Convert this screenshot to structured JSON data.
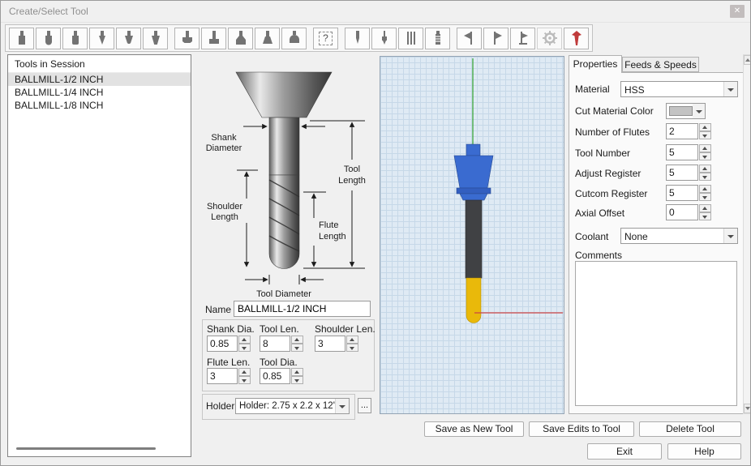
{
  "window": {
    "title": "Create/Select Tool",
    "close_glyph": "✕"
  },
  "toolbar": {
    "icons": [
      {
        "name": "flat-end-mill-icon",
        "glyph": "flat"
      },
      {
        "name": "ball-end-mill-icon",
        "glyph": "ball"
      },
      {
        "name": "bull-nose-mill-icon",
        "glyph": "bull"
      },
      {
        "name": "vee-engraving-tool-icon",
        "glyph": "vee"
      },
      {
        "name": "taper-ball-mill-icon",
        "glyph": "taperball"
      },
      {
        "name": "taper-mill-icon",
        "glyph": "taper"
      },
      {
        "name": "face-mill-icon",
        "glyph": "face"
      },
      {
        "name": "t-slot-cutter-icon",
        "glyph": "tslot"
      },
      {
        "name": "chamfer-mill-icon",
        "glyph": "chamfer"
      },
      {
        "name": "dovetail-cutter-icon",
        "glyph": "dovetail"
      },
      {
        "name": "countersink-icon",
        "glyph": "dome"
      },
      {
        "name": "undefined-tool-icon",
        "glyph": "question"
      },
      {
        "name": "spot-drill-icon",
        "glyph": "spot"
      },
      {
        "name": "center-drill-icon",
        "glyph": "center"
      },
      {
        "name": "thread-mill-icon",
        "glyph": "lines"
      },
      {
        "name": "tap-tool-icon",
        "glyph": "tap"
      },
      {
        "name": "form-tool-left-icon",
        "glyph": "flagl"
      },
      {
        "name": "form-tool-right-icon",
        "glyph": "flagr"
      },
      {
        "name": "lathe-form-tool-icon",
        "glyph": "flagr2"
      },
      {
        "name": "wheel-tool-gear-icon",
        "glyph": "gear"
      },
      {
        "name": "probe-tool-icon",
        "glyph": "probe"
      }
    ]
  },
  "session": {
    "header": "Tools in Session",
    "tools": [
      "BALLMILL-1/2 INCH",
      "BALLMILL-1/4 INCH",
      "BALLMILL-1/8 INCH"
    ],
    "selected_index": 0
  },
  "diagram": {
    "shank_l1": "Shank",
    "shank_l2": "Diameter",
    "tool_l1": "Tool",
    "tool_l2": "Length",
    "shoulder_l1": "Shoulder",
    "shoulder_l2": "Length",
    "flute_l1": "Flute",
    "flute_l2": "Length",
    "tool_diameter": "Tool Diameter"
  },
  "editor": {
    "name_label": "Name",
    "name_value": "BALLMILL-1/2 INCH",
    "fields": [
      {
        "label": "Shank Dia.",
        "value": "0.85"
      },
      {
        "label": "Tool Len.",
        "value": "8"
      },
      {
        "label": "Shoulder Len.",
        "value": "3"
      },
      {
        "label": "Flute Len.",
        "value": "3"
      },
      {
        "label": "Tool Dia.",
        "value": "0.85"
      }
    ],
    "holder_label": "Holder",
    "holder_value": "Holder: 2.75 x 2.2 x 12''",
    "holder_browse": "..."
  },
  "properties": {
    "tab_properties": "Properties",
    "tab_feeds": "Feeds & Speeds",
    "material_label": "Material",
    "material_value": "HSS",
    "cut_color_label": "Cut Material Color",
    "rows": [
      {
        "label": "Number of Flutes",
        "value": "2"
      },
      {
        "label": "Tool Number",
        "value": "5"
      },
      {
        "label": "Adjust Register",
        "value": "5"
      },
      {
        "label": "Cutcom Register",
        "value": "5"
      },
      {
        "label": "Axial Offset",
        "value": "0"
      }
    ],
    "coolant_label": "Coolant",
    "coolant_value": "None",
    "comments_label": "Comments"
  },
  "buttons": {
    "save_new": "Save as New Tool",
    "save_edits": "Save Edits to Tool",
    "delete": "Delete Tool",
    "exit": "Exit",
    "help": "Help"
  }
}
